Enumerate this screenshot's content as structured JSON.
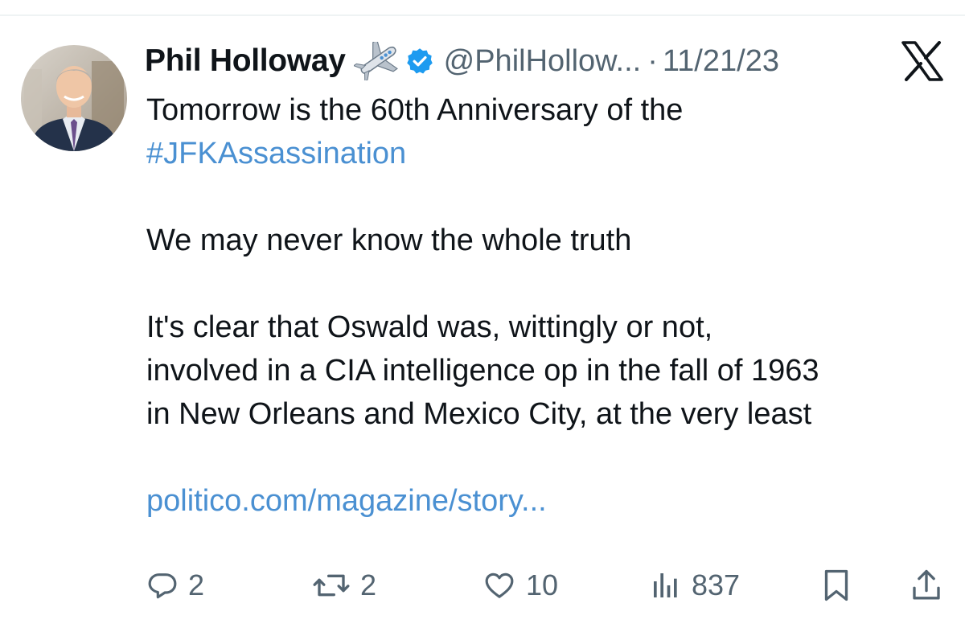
{
  "tweet": {
    "display_name": "Phil Holloway",
    "handle": "@PhilHollow...",
    "separator": "·",
    "date": "11/21/23",
    "body": {
      "line1": "Tomorrow is the 60th Anniversary of the",
      "hashtag": "#JFKAssassination",
      "para2": "We may never know the whole truth",
      "para3_line1": "It's clear that Oswald was, wittingly or not,",
      "para3_line2": "involved in a CIA intelligence op in the fall of 1963",
      "para3_line3": "in New Orleans and Mexico City, at the very least",
      "link": "politico.com/magazine/story..."
    },
    "actions": {
      "replies": "2",
      "reposts": "2",
      "likes": "10",
      "views": "837"
    }
  },
  "icons": {
    "avatar": "avatar-photo",
    "plane": "airplane-emoji",
    "verified": "verified-badge-icon",
    "x_logo": "x-logo-icon",
    "reply": "reply-icon",
    "repost": "repost-icon",
    "like": "heart-icon",
    "views": "views-icon",
    "bookmark": "bookmark-icon",
    "share": "share-icon"
  },
  "colors": {
    "text": "#0f1419",
    "secondary": "#536471",
    "link": "#4a90d2",
    "verified": "#1d9bf0"
  }
}
